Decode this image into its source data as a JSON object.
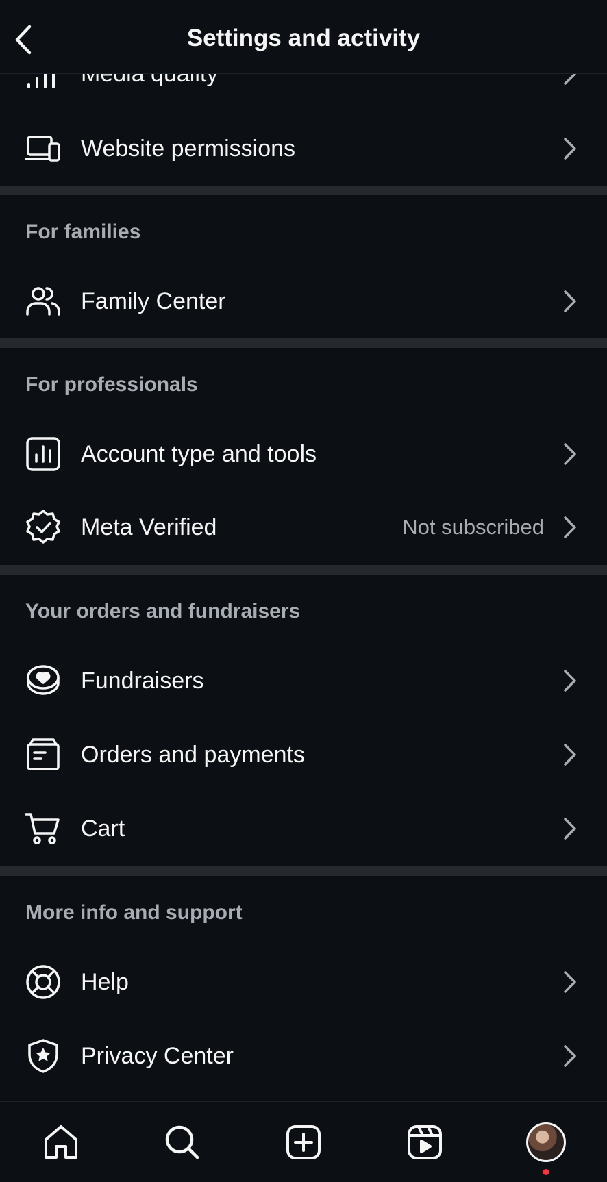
{
  "header": {
    "title": "Settings and activity"
  },
  "rows_top": [
    {
      "id": "media-quality",
      "label": "Media quality"
    },
    {
      "id": "website-permissions",
      "label": "Website permissions"
    }
  ],
  "sections": {
    "families": {
      "title": "For families",
      "items": [
        {
          "label": "Family Center"
        }
      ]
    },
    "professionals": {
      "title": "For professionals",
      "items": [
        {
          "label": "Account type and tools"
        },
        {
          "label": "Meta Verified",
          "value": "Not subscribed"
        }
      ]
    },
    "orders": {
      "title": "Your orders and fundraisers",
      "items": [
        {
          "label": "Fundraisers"
        },
        {
          "label": "Orders and payments"
        },
        {
          "label": "Cart"
        }
      ]
    },
    "support": {
      "title": "More info and support",
      "items": [
        {
          "label": "Help"
        },
        {
          "label": "Privacy Center"
        }
      ]
    }
  },
  "bottom_nav": [
    "home-icon",
    "search-icon",
    "create-icon",
    "reels-icon",
    "profile-avatar"
  ],
  "colors": {
    "background": "#0c1014",
    "divider": "#25292e",
    "text": "#f5f5f5",
    "secondary": "#a8acb3",
    "badge": "#ff3040"
  }
}
